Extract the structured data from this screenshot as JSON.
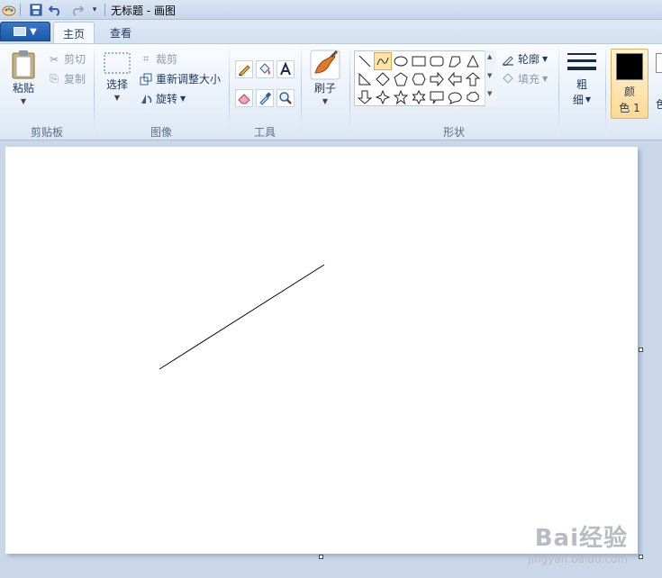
{
  "window": {
    "title": "无标题 - 画图"
  },
  "tabs": [
    {
      "label": "主页",
      "active": true
    },
    {
      "label": "查看",
      "active": false
    }
  ],
  "groups": {
    "clipboard": {
      "label": "剪贴板",
      "paste_label": "粘贴",
      "cut_label": "剪切",
      "copy_label": "复制"
    },
    "image": {
      "label": "图像",
      "select_label": "选择",
      "crop_label": "裁剪",
      "resize_label": "重新调整大小",
      "rotate_label": "旋转"
    },
    "tools": {
      "label": "工具"
    },
    "brushes": {
      "label": "刷子"
    },
    "shapes": {
      "label": "形状",
      "outline_label": "轮廓",
      "fill_label": "填充"
    },
    "size": {
      "label_line1": "粗",
      "label_line2": "细"
    },
    "colors": {
      "color1_line1": "颜",
      "color1_line2": "色 1",
      "color2_partial": "色",
      "color1_value": "#000000"
    }
  },
  "watermark": {
    "brand": "Bai经验",
    "url": "jingyan.baidu.com"
  }
}
